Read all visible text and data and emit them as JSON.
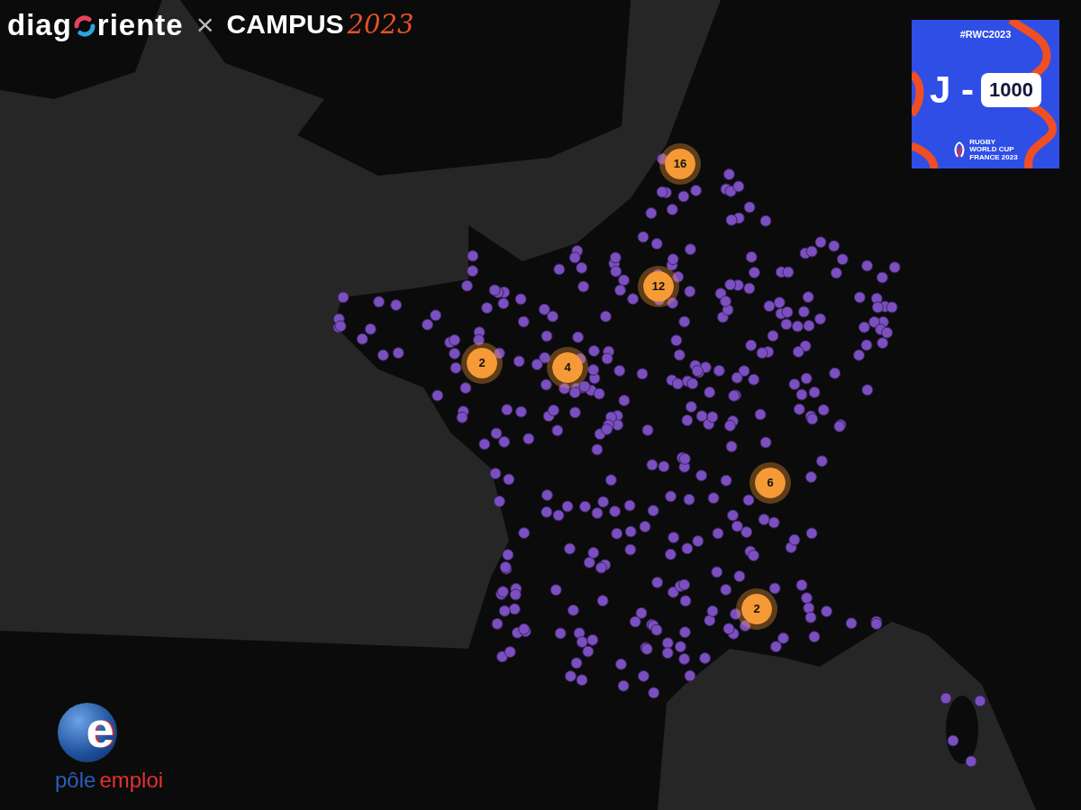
{
  "header": {
    "brand_start": "diag",
    "brand_end": "riente",
    "separator": "×",
    "partner": "CAMPUS",
    "partner_year": "2023"
  },
  "badge": {
    "hashtag": "#RWC2023",
    "prefix": "J -",
    "count": "1000",
    "logo_lines": [
      "RUGBY",
      "WORLD CUP",
      "FRANCE 2023"
    ]
  },
  "map": {
    "kind": "picture",
    "clusters": [
      {
        "count": "16"
      },
      {
        "count": "12"
      },
      {
        "count": "2"
      },
      {
        "count": "4"
      },
      {
        "count": "6"
      },
      {
        "count": "2"
      }
    ]
  },
  "footer_logo": {
    "letter": "e",
    "word_start": "pôle",
    "word_end": "emploi"
  }
}
